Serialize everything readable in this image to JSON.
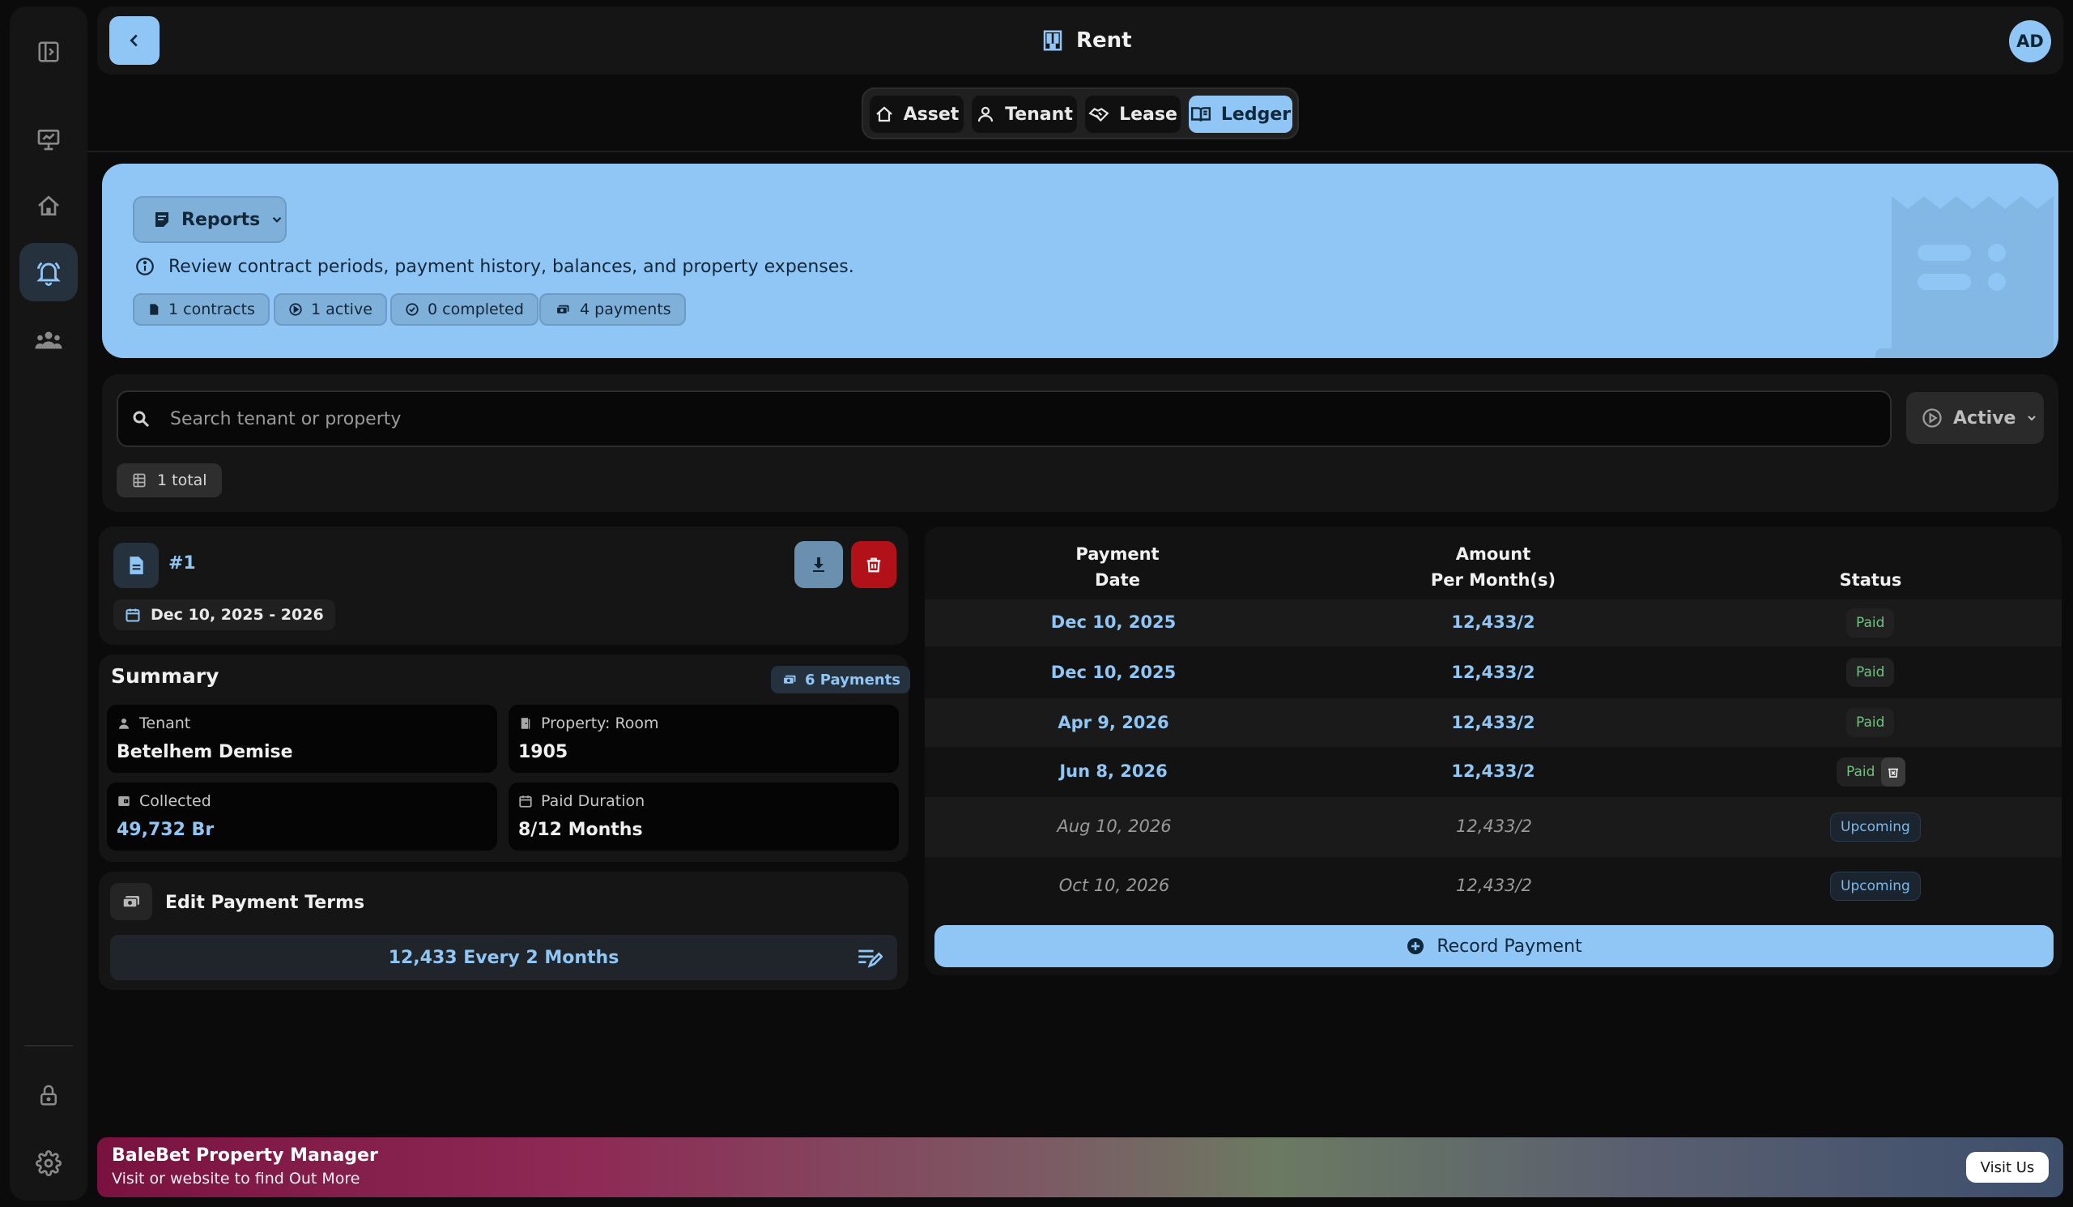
{
  "header": {
    "title": "Rent",
    "avatar_initials": "AD"
  },
  "tabs": [
    {
      "label": "Asset",
      "icon": "house-icon"
    },
    {
      "label": "Tenant",
      "icon": "user-icon"
    },
    {
      "label": "Lease",
      "icon": "handshake-icon"
    },
    {
      "label": "Ledger",
      "icon": "book-icon",
      "active": true
    }
  ],
  "sidebar": {
    "items": [
      {
        "icon": "sidebar-toggle-icon"
      },
      {
        "icon": "presentation-icon"
      },
      {
        "icon": "house-icon"
      },
      {
        "icon": "bell-icon",
        "active": true
      },
      {
        "icon": "group-icon"
      },
      {
        "icon": "lock-icon"
      },
      {
        "icon": "gear-icon"
      }
    ]
  },
  "banner": {
    "reports_label": "Reports",
    "description": "Review contract periods, payment history, balances, and property expenses.",
    "chips": [
      "1 contracts",
      "1 active",
      "0 completed",
      "4 payments"
    ]
  },
  "search": {
    "placeholder": "Search tenant or property",
    "value": ""
  },
  "filter": {
    "status": "Active"
  },
  "total_label": "1 total",
  "contract": {
    "number": "#1",
    "date_range": "Dec 10, 2025 - 2026"
  },
  "summary": {
    "title": "Summary",
    "payments_badge": "6 Payments",
    "tenant_label": "Tenant",
    "tenant_value": "Betelhem Demise",
    "property_label": "Property: Room",
    "property_value": "1905",
    "collected_label": "Collected",
    "collected_value": "49,732 Br",
    "duration_label": "Paid Duration",
    "duration_value": "8/12 Months"
  },
  "terms": {
    "title": "Edit Payment Terms",
    "value": "12,433 Every 2 Months"
  },
  "table": {
    "headers": {
      "date_l1": "Payment",
      "date_l2": "Date",
      "amount_l1": "Amount",
      "amount_l2": "Per Month(s)",
      "status": "Status"
    },
    "rows": [
      {
        "date": "Dec 10, 2025",
        "amount": "12,433/2",
        "status": "Paid"
      },
      {
        "date": "Dec 10, 2025",
        "amount": "12,433/2",
        "status": "Paid"
      },
      {
        "date": "Apr 9, 2026",
        "amount": "12,433/2",
        "status": "Paid"
      },
      {
        "date": "Jun 8, 2026",
        "amount": "12,433/2",
        "status": "Paid"
      },
      {
        "date": "Aug 10, 2026",
        "amount": "12,433/2",
        "status": "Upcoming"
      },
      {
        "date": "Oct 10, 2026",
        "amount": "12,433/2",
        "status": "Upcoming"
      }
    ],
    "record_label": "Record Payment"
  },
  "footer": {
    "title": "BaleBet Property Manager",
    "subtitle": "Visit or website to find Out More",
    "button": "Visit Us"
  },
  "colors": {
    "accent": "#90c6f5",
    "danger": "#b3111a",
    "paid": "#6fc27e",
    "background": "#0b0b0b"
  }
}
